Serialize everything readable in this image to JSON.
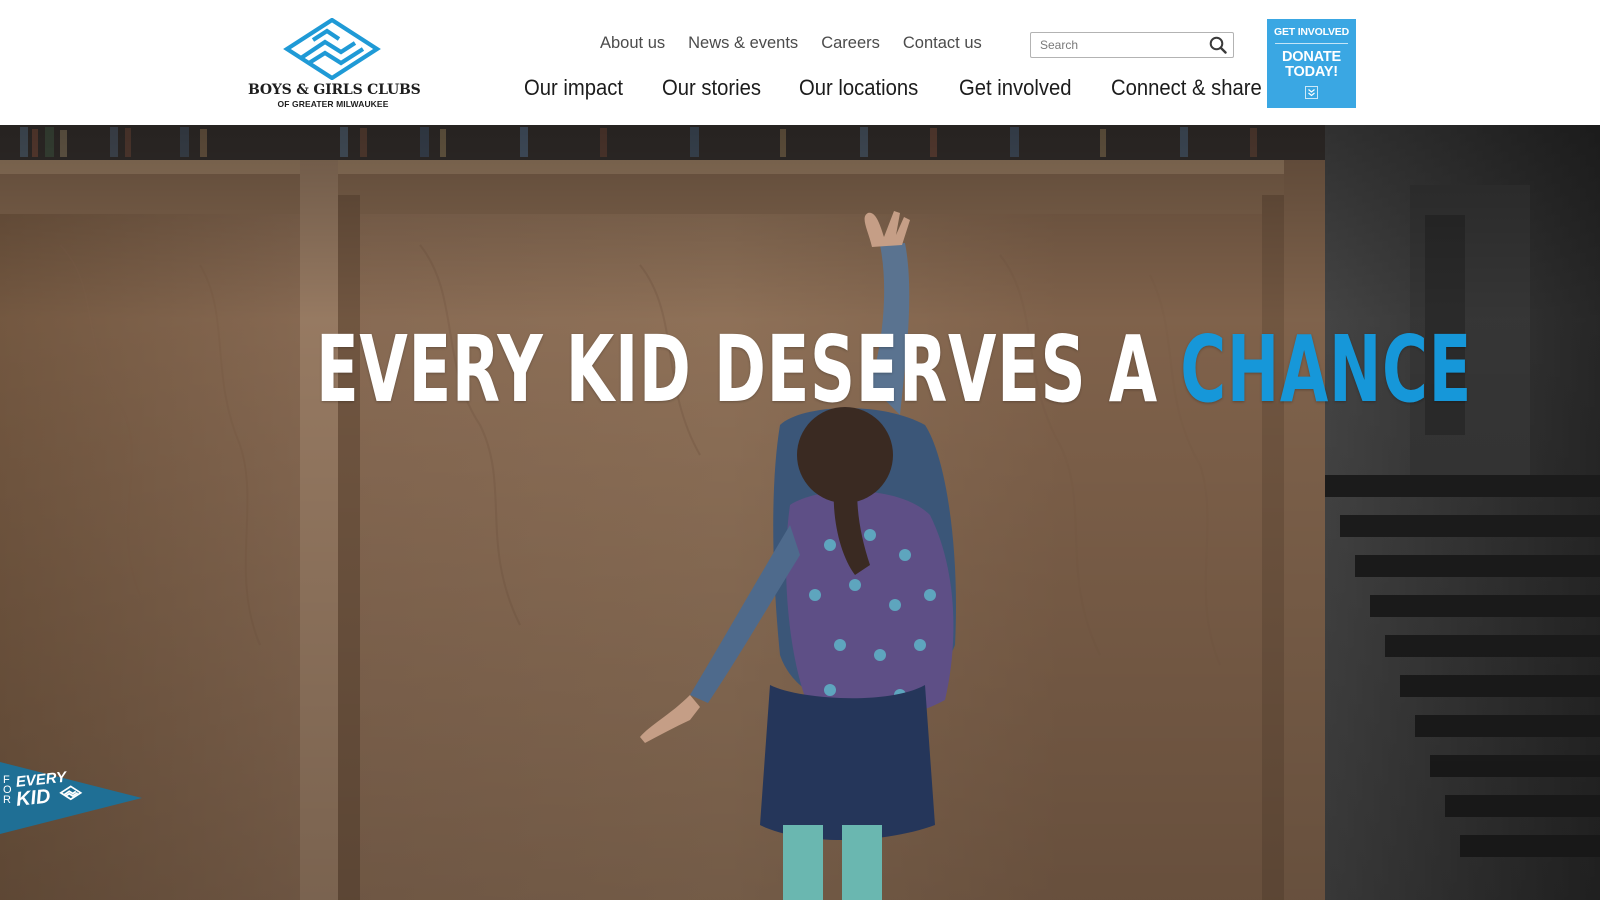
{
  "header": {
    "logo": {
      "name": "BOYS & GIRLS CLUBS",
      "subtitle": "OF GREATER MILWAUKEE",
      "icon": "boys-girls-clubs-hands-icon",
      "color": "#1f9ad6"
    },
    "utility_nav": [
      {
        "label": "About us"
      },
      {
        "label": "News & events"
      },
      {
        "label": "Careers"
      },
      {
        "label": "Contact us"
      }
    ],
    "search": {
      "placeholder": "Search",
      "value": "",
      "icon": "search-icon"
    },
    "main_nav": [
      {
        "label": "Our impact"
      },
      {
        "label": "Our stories"
      },
      {
        "label": "Our locations"
      },
      {
        "label": "Get involved"
      },
      {
        "label": "Connect & share"
      }
    ],
    "donate": {
      "top_label": "GET INVOLVED",
      "main_label_line1": "DONATE",
      "main_label_line2": "TODAY!",
      "icon": "chevron-down-icon",
      "color": "#3aa7e3"
    }
  },
  "hero": {
    "headline_lead": "EVERY KID DESERVES A ",
    "headline_highlight": "CHANCE",
    "highlight_color": "#1697d9",
    "pennant": {
      "for_text": "FOR",
      "every_text": "EVERY",
      "kid_text": "KID",
      "icon": "boys-girls-clubs-hands-icon",
      "color": "#1f6f95"
    }
  }
}
